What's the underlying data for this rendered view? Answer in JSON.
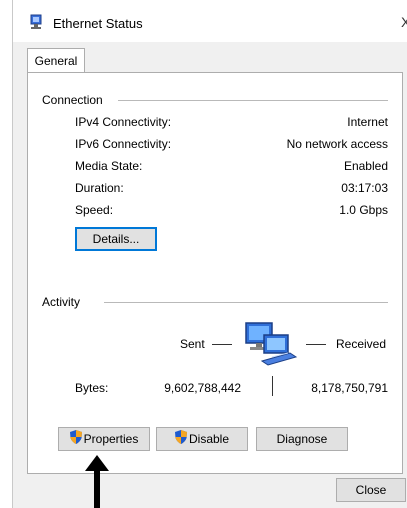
{
  "window": {
    "title": "Ethernet Status",
    "close_glyph": "X"
  },
  "tabs": [
    {
      "label": "General"
    }
  ],
  "connection": {
    "title": "Connection",
    "rows": [
      {
        "label": "IPv4 Connectivity:",
        "value": "Internet"
      },
      {
        "label": "IPv6 Connectivity:",
        "value": "No network access"
      },
      {
        "label": "Media State:",
        "value": "Enabled"
      },
      {
        "label": "Duration:",
        "value": "03:17:03"
      },
      {
        "label": "Speed:",
        "value": "1.0 Gbps"
      }
    ],
    "details_button": "Details..."
  },
  "activity": {
    "title": "Activity",
    "sent_label": "Sent",
    "received_label": "Received",
    "bytes_label": "Bytes:",
    "bytes_sent": "9,602,788,442",
    "bytes_received": "8,178,750,791",
    "icon": "network-computers-icon"
  },
  "buttons": {
    "properties": "Properties",
    "disable": "Disable",
    "diagnose": "Diagnose",
    "close": "Close"
  },
  "colors": {
    "accent": "#0078d7",
    "shield_blue": "#1e5bd0",
    "shield_orange": "#f5a623"
  }
}
